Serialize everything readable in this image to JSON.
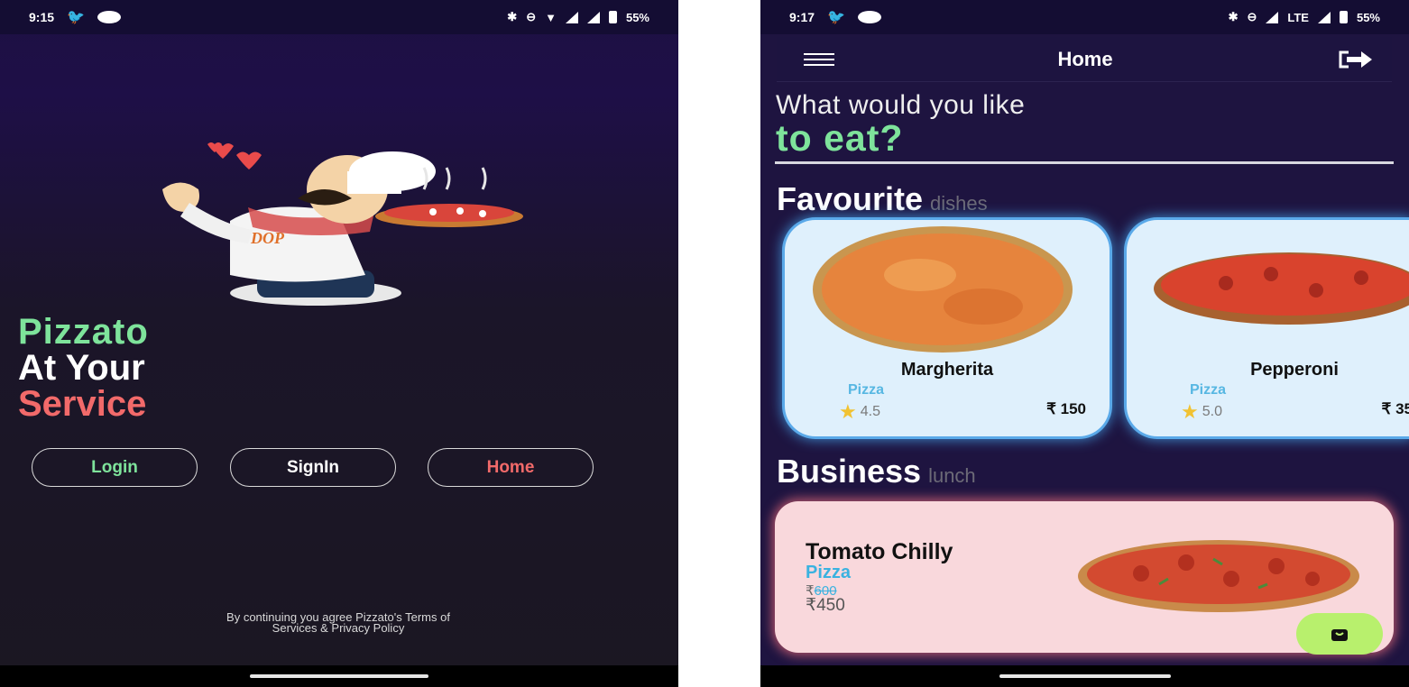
{
  "left": {
    "status": {
      "time": "9:15",
      "battery": "55%"
    },
    "brand": {
      "line1": "Pizzato",
      "line2": "At Your",
      "line3": "Service"
    },
    "chef_logo_text": "DOP",
    "buttons": {
      "login": "Login",
      "signin": "SignIn",
      "home": "Home"
    },
    "terms": {
      "line1": "By continuing you agree Pizzato's Terms of",
      "line2": "Services & Privacy Policy"
    }
  },
  "right": {
    "status": {
      "time": "9:17",
      "network": "LTE",
      "battery": "55%"
    },
    "appbar": {
      "title": "Home"
    },
    "question": {
      "line1": "What would you like",
      "line2": "to eat?"
    },
    "favourite": {
      "title": "Favourite",
      "subtitle": "dishes"
    },
    "favourite_items": [
      {
        "name": "Margherita",
        "category": "Pizza",
        "rating": "4.5",
        "price": "₹ 150"
      },
      {
        "name": "Pepperoni",
        "category": "Pizza",
        "rating": "5.0",
        "price": "₹ 35"
      }
    ],
    "business": {
      "title": "Business",
      "subtitle": "lunch"
    },
    "lunch_item": {
      "name": "Tomato Chilly",
      "category": "Pizza",
      "currency": "₹",
      "old_price": "600",
      "new_price": "₹450"
    }
  },
  "colors": {
    "green": "#7ee39b",
    "red": "#f26a6a",
    "blue": "#57b7e2",
    "fab": "#b8f06d"
  }
}
